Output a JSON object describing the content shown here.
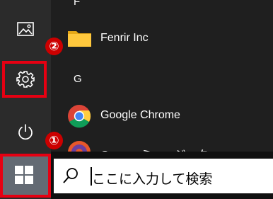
{
  "start_menu": {
    "section_letters": [
      "F",
      "G"
    ],
    "apps": [
      {
        "label": "Fenrir Inc",
        "icon": "folder-icon"
      },
      {
        "label": "Google Chrome",
        "icon": "chrome-icon"
      },
      {
        "label": "Groove ミュージック",
        "icon": "groove-music-icon"
      }
    ],
    "rail": [
      {
        "name": "pictures",
        "icon": "pictures-icon"
      },
      {
        "name": "settings",
        "icon": "gear-icon"
      },
      {
        "name": "power",
        "icon": "power-icon"
      }
    ]
  },
  "markers": {
    "settings": "②",
    "start": "①"
  },
  "taskbar": {
    "start_icon": "windows-logo-icon",
    "search_icon": "search-icon",
    "search_placeholder": "ここに入力して検索"
  },
  "colors": {
    "highlight": "#e60012",
    "marker": "#cc0000",
    "menu_bg": "#1f1f1f",
    "rail_bg": "#2b2b2b"
  }
}
